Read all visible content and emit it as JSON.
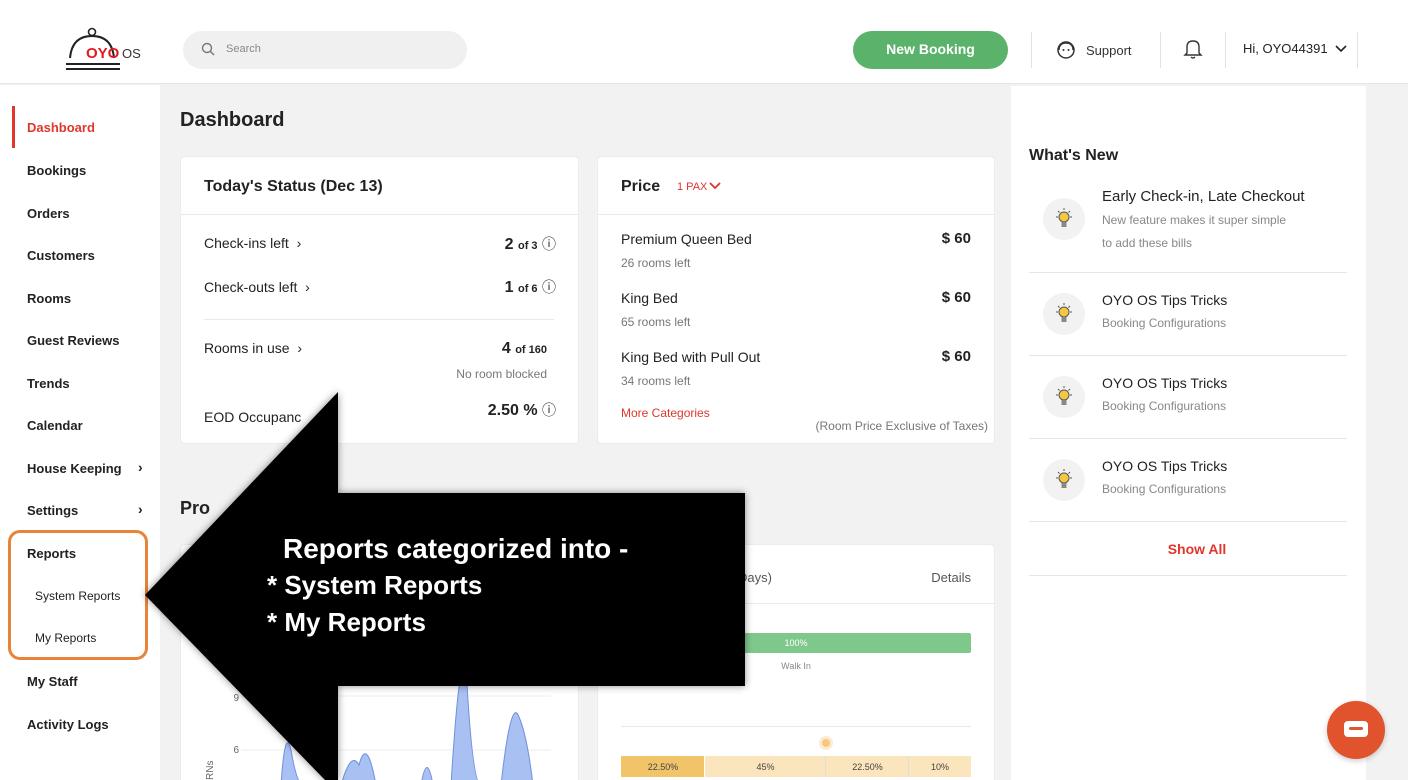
{
  "brand": {
    "logo_text": "OYO",
    "logo_suffix": "OS"
  },
  "search": {
    "placeholder": "Search"
  },
  "header": {
    "new_booking_label": "New Booking",
    "support_label": "Support",
    "user_greeting": "Hi, OYO44391"
  },
  "sidebar": {
    "items": [
      {
        "label": "Dashboard"
      },
      {
        "label": "Bookings"
      },
      {
        "label": "Orders"
      },
      {
        "label": "Customers"
      },
      {
        "label": "Rooms"
      },
      {
        "label": "Guest Reviews"
      },
      {
        "label": "Trends"
      },
      {
        "label": "Calendar"
      },
      {
        "label": "House Keeping"
      },
      {
        "label": "Settings"
      },
      {
        "label": "Reports"
      },
      {
        "label": "My Staff"
      },
      {
        "label": "Activity Logs"
      }
    ],
    "reports_sub": [
      {
        "label": "System Reports"
      },
      {
        "label": "My Reports"
      }
    ]
  },
  "main": {
    "title": "Dashboard",
    "promo_partial": "Pro",
    "todays_status": {
      "title": "Today's Status (Dec 13)",
      "checkins_label": "Check-ins left",
      "checkins_value": "2",
      "checkins_of": "of 3",
      "checkouts_label": "Check-outs left",
      "checkouts_value": "1",
      "checkouts_of": "of 6",
      "rooms_label": "Rooms in use",
      "rooms_value": "4",
      "rooms_of": "of 160",
      "rooms_note": "No room blocked",
      "eod_label": "EOD Occupanc",
      "eod_value": "2.50 %"
    },
    "price": {
      "title": "Price",
      "pax": "1 PAX",
      "rooms": [
        {
          "name": "Premium Queen Bed",
          "left": "26 rooms left",
          "price": "$ 60"
        },
        {
          "name": "King Bed",
          "left": "65 rooms left",
          "price": "$ 60"
        },
        {
          "name": "King Bed with Pull Out",
          "left": "34 rooms left",
          "price": "$ 60"
        }
      ],
      "more_label": "More Categories",
      "note": "(Room Price Exclusive of Taxes)"
    },
    "booking_card": {
      "days_partial": "Days)",
      "details_label": "Details",
      "walkin_pct": "100%",
      "walkin_label": "Walk In",
      "segments": [
        "22.50%",
        "45%",
        "22.50%",
        "10%"
      ]
    },
    "chart": {
      "y_ticks": [
        "9",
        "6"
      ],
      "y_label_partial": "RNs"
    }
  },
  "whats_new": {
    "title": "What's New",
    "items": [
      {
        "title": "Early Check-in, Late Checkout",
        "sub1": "New feature makes it super simple",
        "sub2": "to add these bills"
      },
      {
        "title": "OYO OS Tips Tricks",
        "sub1": "Booking Configurations",
        "sub2": ""
      },
      {
        "title": "OYO OS Tips Tricks",
        "sub1": "Booking Configurations",
        "sub2": ""
      },
      {
        "title": "OYO OS Tips Tricks",
        "sub1": "Booking Configurations",
        "sub2": ""
      }
    ],
    "show_all": "Show All"
  },
  "annotation": {
    "line1": "Reports categorized into -",
    "line2": "* System Reports",
    "line3": "* My Reports"
  },
  "colors": {
    "accent_red": "#e0362c",
    "green": "#5bb36b",
    "highlight_orange": "#e8833a"
  }
}
